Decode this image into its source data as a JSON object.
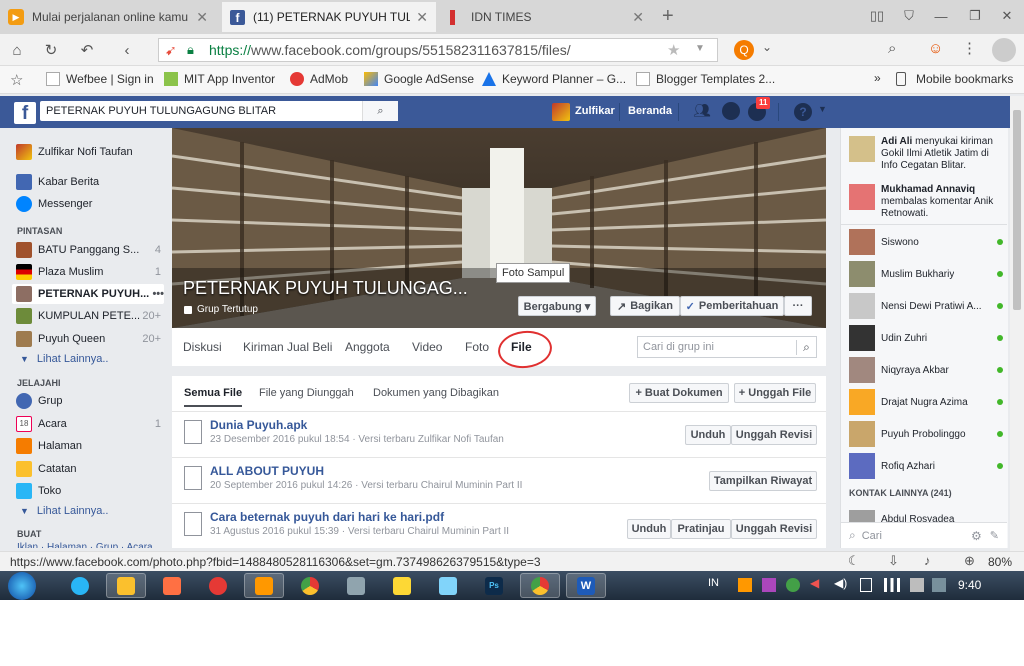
{
  "browser": {
    "tabs": [
      {
        "title": "Mulai perjalanan online kamu",
        "active": false
      },
      {
        "title": "(11) PETERNAK PUYUH TULUNGAGUNG",
        "active": true
      },
      {
        "title": "IDN TIMES",
        "active": false
      }
    ],
    "url_scheme": "https://",
    "url_rest": "www.facebook.com/groups/551582311637815/files/",
    "bookmarks": [
      {
        "label": "Wefbee | Sign in"
      },
      {
        "label": "MIT App Inventor"
      },
      {
        "label": "AdMob"
      },
      {
        "label": "Google AdSense"
      },
      {
        "label": "Keyword Planner – G..."
      },
      {
        "label": "Blogger Templates 2..."
      }
    ],
    "bookmarks_more": "»",
    "mobile_bookmarks": "Mobile bookmarks",
    "status_url": "https://www.facebook.com/photo.php?fbid=1488480528116306&set=gm.737498626379515&type=3",
    "zoom": "80%"
  },
  "fb": {
    "search_value": "PETERNAK  PUYUH TULUNGAGUNG BLITAR",
    "user_name": "Zulfikar",
    "home_label": "Beranda",
    "notif_count": "11"
  },
  "left": {
    "profile": "Zulfikar Nofi Taufan",
    "main": [
      {
        "label": "Kabar Berita"
      },
      {
        "label": "Messenger"
      }
    ],
    "shortcuts_title": "PINTASAN",
    "shortcuts": [
      {
        "label": "BATU Panggang S...",
        "count": "4"
      },
      {
        "label": "Plaza Muslim",
        "count": "1"
      },
      {
        "label": "PETERNAK PUYUH...",
        "count": "•••"
      },
      {
        "label": "KUMPULAN PETE...",
        "count": "20+"
      },
      {
        "label": "Puyuh Queen",
        "count": "20+"
      }
    ],
    "see_more_1": "Lihat Lainnya..",
    "explore_title": "JELAJAHI",
    "explore": [
      {
        "label": "Grup",
        "count": ""
      },
      {
        "label": "Acara",
        "count": "1"
      },
      {
        "label": "Halaman",
        "count": ""
      },
      {
        "label": "Catatan",
        "count": ""
      },
      {
        "label": "Toko",
        "count": ""
      }
    ],
    "see_more_2": "Lihat Lainnya..",
    "create_title": "BUAT",
    "create_links": "Iklan · Halaman · Grup · Acara"
  },
  "group": {
    "name": "PETERNAK PUYUH TULUNGAG...",
    "privacy": "Grup Tertutup",
    "cover_tooltip": "Foto Sampul",
    "join_button": "Bergabung ▾",
    "share_button": "Bagikan",
    "notify_button": "Pemberitahuan",
    "more_button": "···",
    "tabs": [
      {
        "label": "Diskusi"
      },
      {
        "label": "Kiriman Jual Beli"
      },
      {
        "label": "Anggota"
      },
      {
        "label": "Video"
      },
      {
        "label": "Foto"
      },
      {
        "label": "File"
      }
    ],
    "search_placeholder": "Cari di grup ini"
  },
  "files": {
    "filter_tabs": [
      {
        "label": "Semua File"
      },
      {
        "label": "File yang Diunggah"
      },
      {
        "label": "Dokumen yang Dibagikan"
      }
    ],
    "create_doc": "+ Buat Dokumen",
    "upload_file": "+ Unggah File",
    "items": [
      {
        "name": "Dunia Puyuh.apk",
        "meta": "23 Desember 2016 pukul 18:54 · Versi terbaru Zulfikar Nofi Taufan",
        "actions": [
          "Unduh",
          "Unggah Revisi"
        ]
      },
      {
        "name": "ALL ABOUT PUYUH",
        "meta": "20 September 2016 pukul 14:26 · Versi terbaru Chairul Muminin Part II",
        "actions": [
          "Tampilkan Riwayat"
        ]
      },
      {
        "name": "Cara beternak puyuh dari hari ke hari.pdf",
        "meta": "31 Agustus 2016 pukul 15:39 · Versi terbaru Chairul Muminin Part II",
        "actions": [
          "Unduh",
          "Pratinjau",
          "Unggah Revisi"
        ]
      }
    ]
  },
  "right": {
    "activity": [
      {
        "name": "Adi Ali",
        "text": " menyukai kiriman Gokil Ilmi Atletik Jatim di Info Cegatan Blitar."
      },
      {
        "name": "Mukhamad Annaviq",
        "text": " membalas komentar Anik Retnowati."
      }
    ],
    "contacts": [
      {
        "name": "Siswono"
      },
      {
        "name": "Muslim Bukhariy"
      },
      {
        "name": "Nensi Dewi Pratiwi A..."
      },
      {
        "name": "Udin Zuhri"
      },
      {
        "name": "Niqyraya Akbar"
      },
      {
        "name": "Drajat Nugra Azima"
      },
      {
        "name": "Puyuh Probolinggo"
      },
      {
        "name": "Rofiq Azhari"
      }
    ],
    "other_contacts": "KONTAK LAINNYA (241)",
    "partial_contact": "Abdul Rosyadea",
    "search_placeholder": "Cari"
  },
  "taskbar": {
    "lang": "IN",
    "time": "9:40"
  }
}
